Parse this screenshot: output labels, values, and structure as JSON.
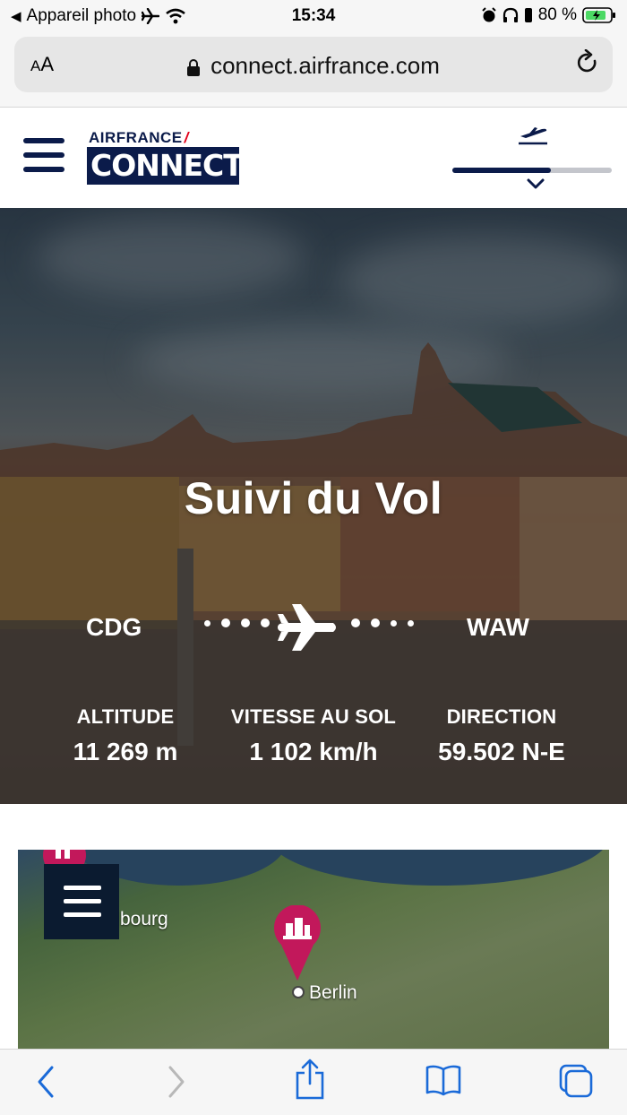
{
  "status_bar": {
    "back_app": "Appareil photo",
    "time": "15:34",
    "battery": "80 %"
  },
  "browser": {
    "text_size": "AA",
    "url": "connect.airfrance.com"
  },
  "header": {
    "logo_top": "AIRFRANCE",
    "logo_bottom": "CONNECT",
    "flight_progress": 0.62
  },
  "hero": {
    "title": "Suivi du Vol",
    "origin": "CDG",
    "destination": "WAW",
    "stats": [
      {
        "label": "ALTITUDE",
        "value": "11 269 m"
      },
      {
        "label": "VITESSE AU SOL",
        "value": "1 102 km/h"
      },
      {
        "label": "DIRECTION",
        "value": "59.502 N-E"
      }
    ]
  },
  "map": {
    "labels": [
      "bourg",
      "Berlin"
    ]
  },
  "colors": {
    "navy": "#0b1b4a",
    "brand_red": "#e2001a",
    "pin_magenta": "#c2185b",
    "ios_blue": "#1a6ad8"
  }
}
